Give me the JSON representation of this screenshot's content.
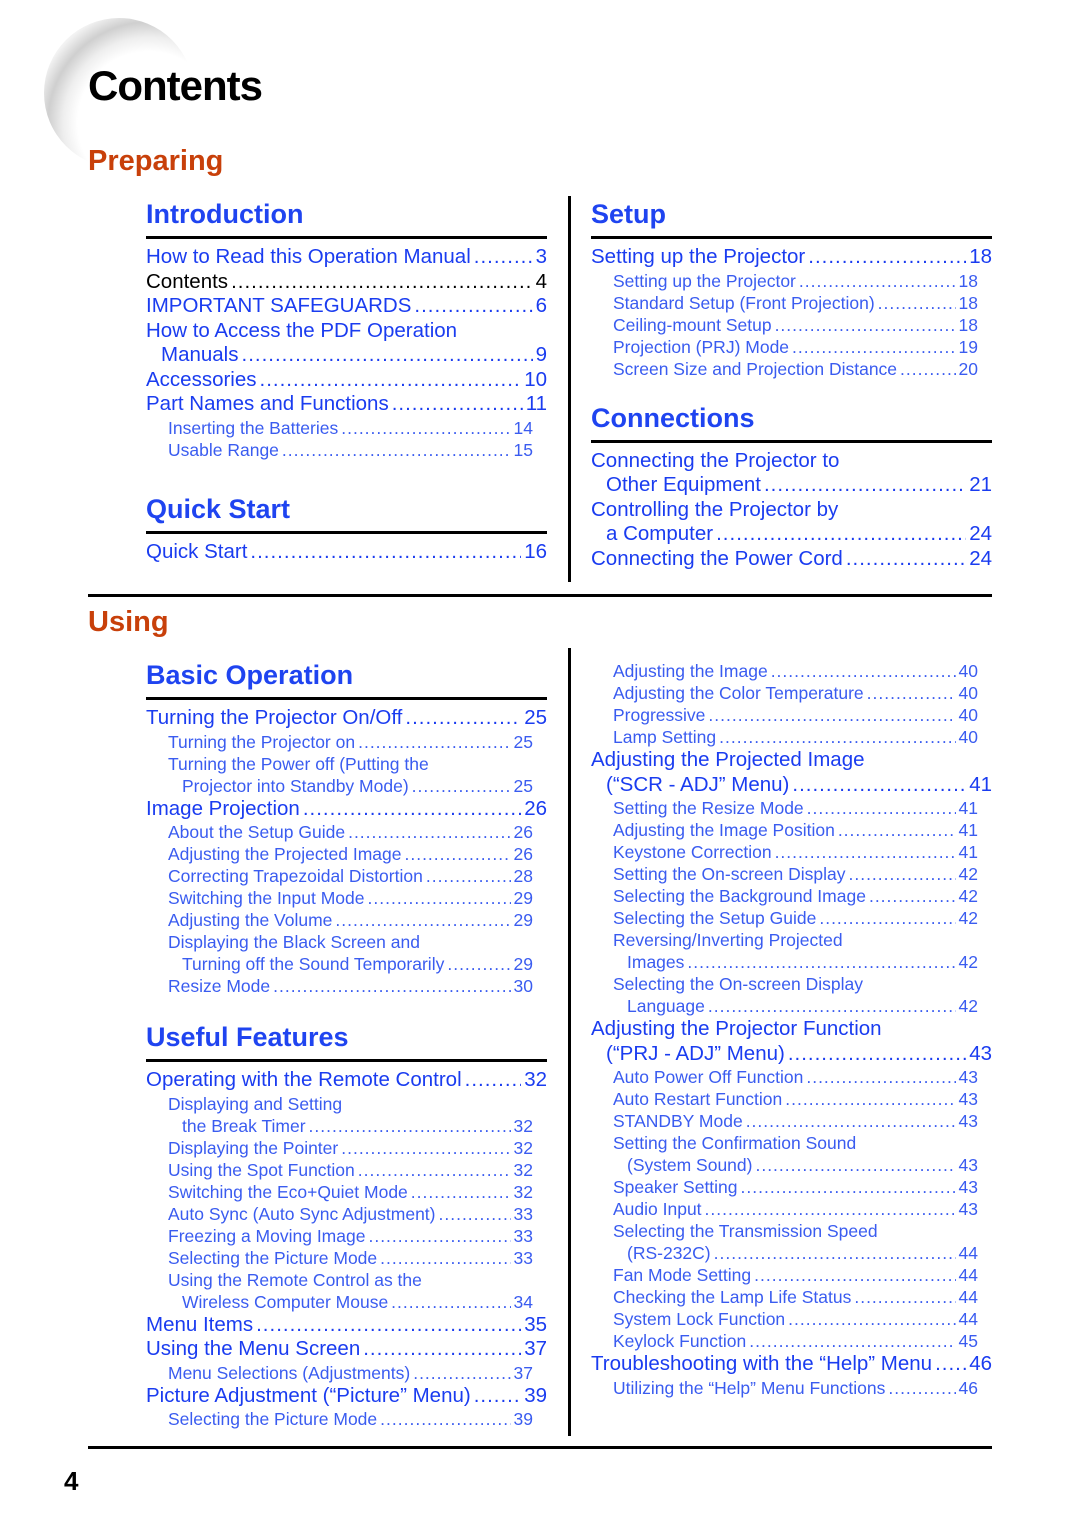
{
  "page": {
    "title": "Contents",
    "page_number": "4",
    "colors": {
      "part_heading": "#c8400a",
      "section_heading": "#1f44f0",
      "entry_main": "#1a3cf0",
      "entry_sub": "#3a5cf0",
      "rule": "#000000"
    }
  },
  "preparing": {
    "title": "Preparing",
    "introduction": {
      "title": "Introduction",
      "entries": [
        {
          "text": "How to Read this Operation Manual",
          "page": "3"
        },
        {
          "text": "Contents",
          "page": "4"
        },
        {
          "text": "IMPORTANT SAFEGUARDS",
          "page": "6"
        },
        {
          "text": "How to Access the PDF Operation",
          "cont": "Manuals",
          "page": "9"
        },
        {
          "text": "Accessories",
          "page": "10"
        },
        {
          "text": "Part Names and Functions",
          "page": "11"
        }
      ],
      "subentries": [
        {
          "text": "Inserting the Batteries",
          "page": "14"
        },
        {
          "text": "Usable Range",
          "page": "15"
        }
      ]
    },
    "quick_start": {
      "title": "Quick Start",
      "entries": [
        {
          "text": "Quick Start",
          "page": "16"
        }
      ]
    },
    "setup": {
      "title": "Setup",
      "entries": [
        {
          "text": "Setting up the Projector",
          "page": "18"
        }
      ],
      "subentries": [
        {
          "text": "Setting up the Projector",
          "page": "18"
        },
        {
          "text": "Standard Setup (Front Projection)",
          "page": "18"
        },
        {
          "text": "Ceiling-mount Setup",
          "page": "18"
        },
        {
          "text": "Projection (PRJ) Mode",
          "page": "19"
        },
        {
          "text": "Screen Size and Projection Distance",
          "page": "20"
        }
      ]
    },
    "connections": {
      "title": "Connections",
      "entries": [
        {
          "text": "Connecting the Projector to",
          "cont": "Other Equipment",
          "page": "21"
        },
        {
          "text": "Controlling the Projector by",
          "cont": "a Computer",
          "page": "24"
        },
        {
          "text": "Connecting the Power Cord",
          "page": "24"
        }
      ]
    }
  },
  "using": {
    "title": "Using",
    "basic_operation": {
      "title": "Basic Operation",
      "entries": [
        {
          "text": "Turning the Projector On/Off",
          "page": "25"
        },
        {
          "text": "Image Projection",
          "page": "26"
        }
      ],
      "sub_onoff": [
        {
          "text": "Turning the Projector on",
          "page": "25"
        },
        {
          "text": "Turning the Power off (Putting the",
          "cont": "Projector into Standby Mode)",
          "page": "25"
        }
      ],
      "sub_image": [
        {
          "text": "About the Setup Guide",
          "page": "26"
        },
        {
          "text": "Adjusting the Projected Image",
          "page": "26"
        },
        {
          "text": "Correcting Trapezoidal Distortion",
          "page": "28"
        },
        {
          "text": "Switching the Input Mode",
          "page": "29"
        },
        {
          "text": "Adjusting the Volume",
          "page": "29"
        },
        {
          "text": "Displaying the Black Screen and",
          "cont": "Turning off the Sound Temporarily",
          "page": "29"
        },
        {
          "text": "Resize Mode",
          "page": "30"
        }
      ]
    },
    "useful_features": {
      "title": "Useful Features",
      "entries": [
        {
          "text": "Operating with the Remote Control",
          "page": "32"
        },
        {
          "text": "Menu Items",
          "page": "35"
        },
        {
          "text": "Using the Menu Screen",
          "page": "37"
        },
        {
          "text": "Picture Adjustment (“Picture” Menu)",
          "page": "39"
        }
      ],
      "sub_remote": [
        {
          "text": "Displaying and Setting",
          "cont": "the Break Timer",
          "page": "32"
        },
        {
          "text": "Displaying the Pointer",
          "page": "32"
        },
        {
          "text": "Using the Spot Function",
          "page": "32"
        },
        {
          "text": "Switching the Eco+Quiet Mode",
          "page": "32"
        },
        {
          "text": "Auto Sync (Auto Sync Adjustment)",
          "page": "33"
        },
        {
          "text": "Freezing a Moving Image",
          "page": "33"
        },
        {
          "text": "Selecting the Picture Mode",
          "page": "33"
        },
        {
          "text": "Using the Remote Control as the",
          "cont": "Wireless Computer Mouse",
          "page": "34"
        }
      ],
      "sub_menu": [
        {
          "text": "Menu Selections (Adjustments)",
          "page": "37"
        }
      ],
      "sub_picture": [
        {
          "text": "Selecting the Picture Mode",
          "page": "39"
        }
      ]
    },
    "right_column": {
      "sub_picture_cont": [
        {
          "text": "Adjusting the Image",
          "page": "40"
        },
        {
          "text": "Adjusting the Color Temperature",
          "page": "40"
        },
        {
          "text": "Progressive",
          "page": "40"
        },
        {
          "text": "Lamp Setting",
          "page": "40"
        }
      ],
      "scr_adj": {
        "text": "Adjusting the Projected Image",
        "cont": "(“SCR - ADJ” Menu)",
        "page": "41"
      },
      "sub_scr": [
        {
          "text": "Setting the Resize Mode",
          "page": "41"
        },
        {
          "text": "Adjusting the Image Position",
          "page": "41"
        },
        {
          "text": "Keystone Correction",
          "page": "41"
        },
        {
          "text": "Setting the On-screen Display",
          "page": "42"
        },
        {
          "text": "Selecting the Background Image",
          "page": "42"
        },
        {
          "text": "Selecting the Setup Guide",
          "page": "42"
        },
        {
          "text": "Reversing/Inverting Projected",
          "cont": "Images",
          "page": "42"
        },
        {
          "text": "Selecting the On-screen Display",
          "cont": "Language",
          "page": "42"
        }
      ],
      "prj_adj": {
        "text": "Adjusting the Projector Function",
        "cont": "(“PRJ - ADJ” Menu)",
        "page": "43"
      },
      "sub_prj": [
        {
          "text": "Auto Power Off Function",
          "page": "43"
        },
        {
          "text": "Auto Restart Function",
          "page": "43"
        },
        {
          "text": "STANDBY Mode",
          "page": "43"
        },
        {
          "text": "Setting the Confirmation Sound",
          "cont": "(System Sound)",
          "page": "43"
        },
        {
          "text": "Speaker Setting",
          "page": "43"
        },
        {
          "text": "Audio Input",
          "page": "43"
        },
        {
          "text": "Selecting the Transmission Speed",
          "cont": "(RS-232C)",
          "page": "44"
        },
        {
          "text": "Fan Mode Setting",
          "page": "44"
        },
        {
          "text": "Checking the Lamp Life Status",
          "page": "44"
        },
        {
          "text": "System Lock Function",
          "page": "44"
        },
        {
          "text": "Keylock Function",
          "page": "45"
        }
      ],
      "help": {
        "text": "Troubleshooting with the “Help” Menu",
        "page": "46"
      },
      "sub_help": [
        {
          "text": "Utilizing the “Help” Menu Functions",
          "page": "46"
        }
      ]
    }
  }
}
